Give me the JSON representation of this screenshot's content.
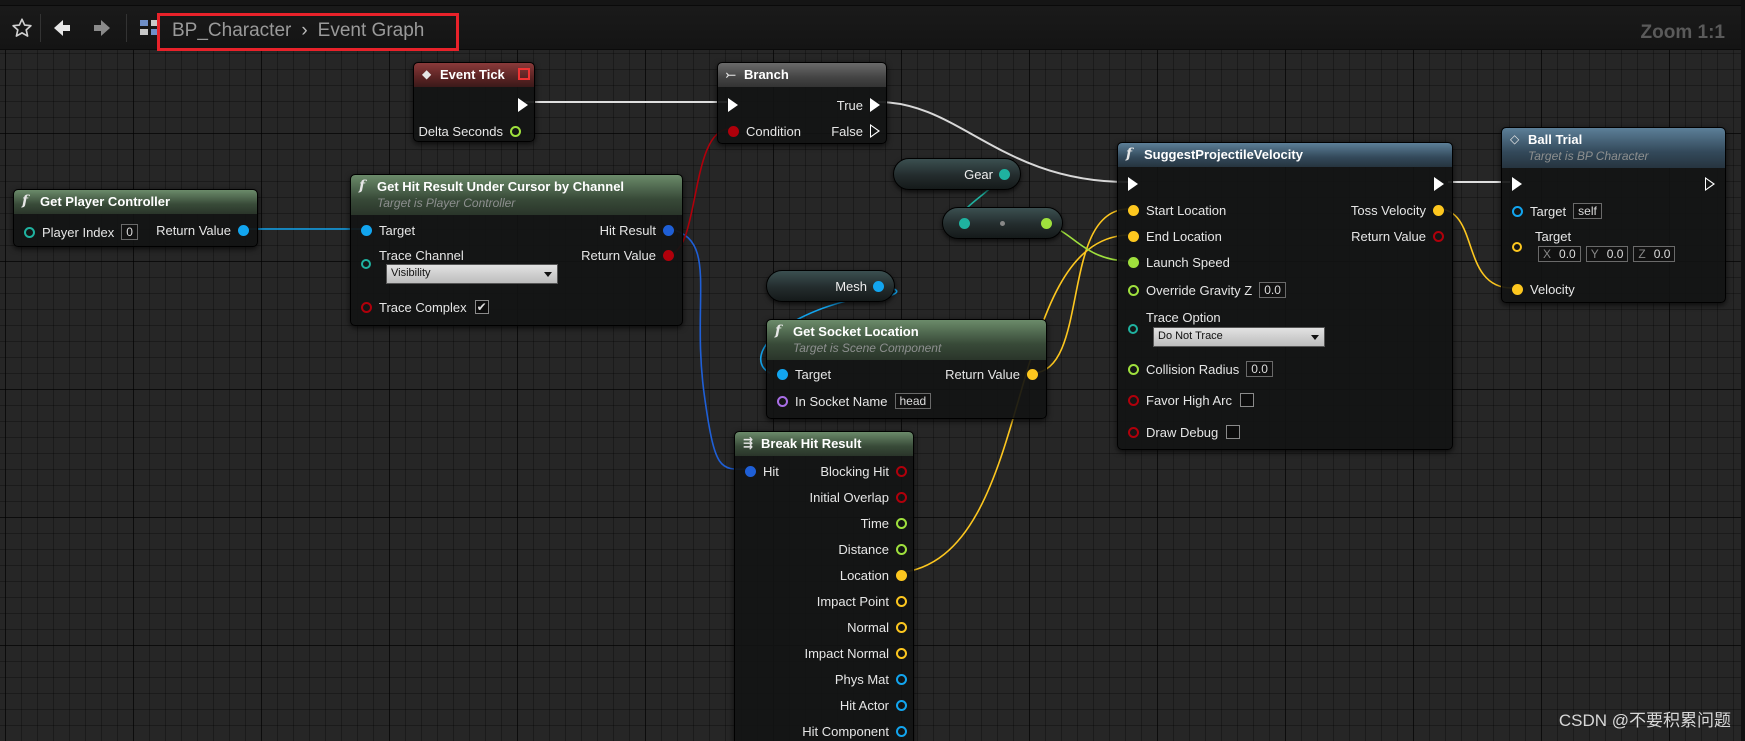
{
  "toolbar": {
    "breadcrumb": [
      "BP_Character",
      "Event Graph"
    ],
    "breadcrumb_separator": "›",
    "zoom": "Zoom 1:1",
    "icons": [
      "star-icon",
      "back-arrow-icon",
      "forward-arrow-icon",
      "hierarchy-icon"
    ]
  },
  "nodes": {
    "event_tick": {
      "title": "Event Tick",
      "outputs": {
        "delta": "Delta Seconds"
      }
    },
    "branch": {
      "title": "Branch",
      "inputs": {
        "condition": "Condition"
      },
      "outputs": {
        "true": "True",
        "false": "False"
      }
    },
    "get_player_controller": {
      "title": "Get Player Controller",
      "inputs": {
        "player_index": "Player Index",
        "player_index_value": "0"
      },
      "outputs": {
        "return": "Return Value"
      }
    },
    "hit_result": {
      "title": "Get Hit Result Under Cursor by Channel",
      "subtitle": "Target is Player Controller",
      "inputs": {
        "target": "Target",
        "trace_channel": "Trace Channel",
        "trace_channel_value": "Visibility",
        "trace_complex": "Trace Complex",
        "trace_complex_checked": "✔"
      },
      "outputs": {
        "hit_result": "Hit Result",
        "return": "Return Value"
      }
    },
    "gear_var": {
      "label": "Gear"
    },
    "mesh_var": {
      "label": "Mesh"
    },
    "get_socket_location": {
      "title": "Get Socket Location",
      "subtitle": "Target is Scene Component",
      "inputs": {
        "target": "Target",
        "socket_name": "In Socket Name",
        "socket_name_value": "head"
      },
      "outputs": {
        "return": "Return Value"
      }
    },
    "break_hit_result": {
      "title": "Break Hit Result",
      "inputs": {
        "hit": "Hit"
      },
      "outputs": [
        "Blocking Hit",
        "Initial Overlap",
        "Time",
        "Distance",
        "Location",
        "Impact Point",
        "Normal",
        "Impact Normal",
        "Phys Mat",
        "Hit Actor",
        "Hit Component"
      ]
    },
    "suggest": {
      "title": "SuggestProjectileVelocity",
      "inputs": {
        "start": "Start Location",
        "end": "End Location",
        "launch": "Launch Speed",
        "gravity": "Override Gravity Z",
        "gravity_value": "0.0",
        "trace_option": "Trace Option",
        "trace_option_value": "Do Not Trace",
        "collision": "Collision Radius",
        "collision_value": "0.0",
        "high_arc": "Favor High Arc",
        "debug": "Draw Debug"
      },
      "outputs": {
        "toss": "Toss Velocity",
        "return": "Return Value"
      }
    },
    "ball_trial": {
      "title": "Ball Trial",
      "subtitle": "Target is BP Character",
      "inputs": {
        "target": "Target",
        "target_value": "self",
        "target_vec": "Target",
        "x_label": "X",
        "x_value": "0.0",
        "y_label": "Y",
        "y_value": "0.0",
        "z_label": "Z",
        "z_value": "0.0",
        "velocity": "Velocity"
      }
    }
  },
  "watermark": "CSDN @不要积累问题",
  "colors": {
    "exec": "#ffffff",
    "object": "#12a5ef",
    "struct_hit": "#1f5fd6",
    "bool": "#b0000b",
    "vector": "#fdc71f",
    "float": "#9fe03d",
    "byte_enum": "#1fb2a0",
    "name": "#a96ee6",
    "highlight": "#e8222a"
  }
}
